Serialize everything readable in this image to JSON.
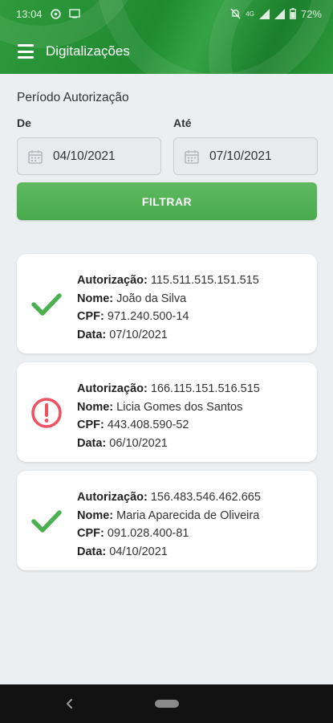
{
  "status_bar": {
    "time": "13:04",
    "network_label": "4G",
    "battery": "72%"
  },
  "toolbar": {
    "title": "Digitalizações",
    "menu_icon": "hamburger-menu-icon"
  },
  "filter": {
    "section_title": "Período Autorização",
    "from_label": "De",
    "to_label": "Até",
    "from_value": "04/10/2021",
    "to_value": "07/10/2021",
    "button_label": "FILTRAR"
  },
  "labels": {
    "autorizacao": "Autorização:",
    "nome": "Nome:",
    "cpf": "CPF:",
    "data": "Data:"
  },
  "records": [
    {
      "status": "approved",
      "status_icon": "check-icon",
      "status_color": "#4caf50",
      "autorizacao": "115.511.515.151.515",
      "nome": "João da Silva",
      "cpf": "971.240.500-14",
      "data": "07/10/2021"
    },
    {
      "status": "error",
      "status_icon": "alert-icon",
      "status_color": "#ef5361",
      "autorizacao": "166.115.151.516.515",
      "nome": "Licia Gomes dos Santos",
      "cpf": "443.408.590-52",
      "data": "06/10/2021"
    },
    {
      "status": "approved",
      "status_icon": "check-icon",
      "status_color": "#4caf50",
      "autorizacao": "156.483.546.462.665",
      "nome": "Maria Aparecida de Oliveira",
      "cpf": "091.028.400-81",
      "data": "04/10/2021"
    }
  ],
  "colors": {
    "brand_green": "#2f9a3c",
    "button_green": "#55b257",
    "background": "#eceff1"
  }
}
